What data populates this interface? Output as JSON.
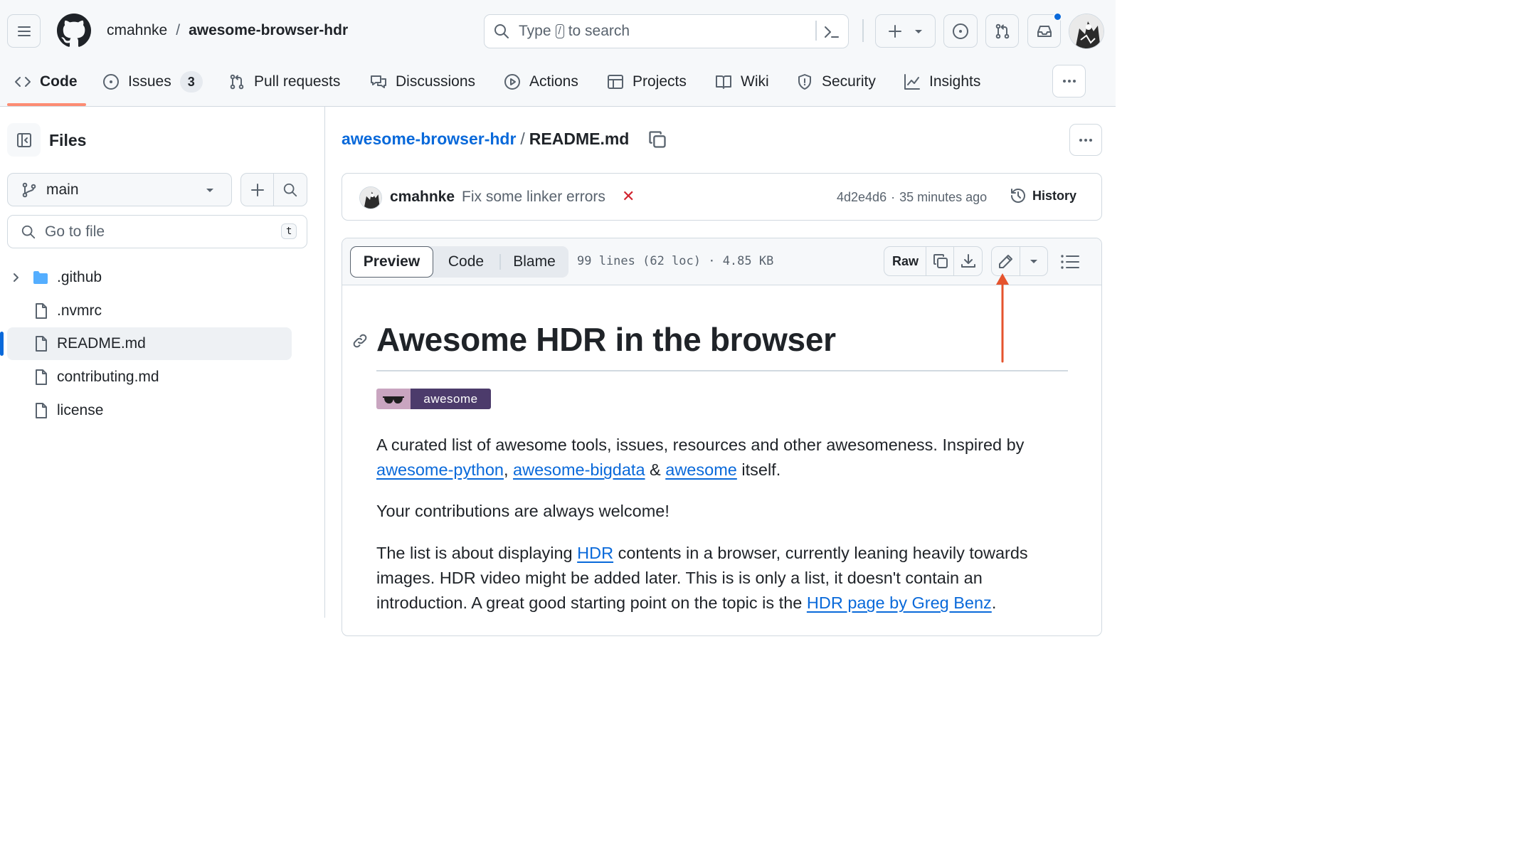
{
  "header": {
    "owner": "cmahnke",
    "separator": "/",
    "repo": "awesome-browser-hdr",
    "search": {
      "prefix": "Type",
      "key": "/",
      "suffix": "to search"
    }
  },
  "tabs": [
    {
      "label": "Code",
      "icon": "code-icon",
      "active": true
    },
    {
      "label": "Issues",
      "icon": "issue-opened-icon",
      "count": "3"
    },
    {
      "label": "Pull requests",
      "icon": "git-pull-request-icon"
    },
    {
      "label": "Discussions",
      "icon": "comment-discussion-icon"
    },
    {
      "label": "Actions",
      "icon": "play-icon"
    },
    {
      "label": "Projects",
      "icon": "table-icon"
    },
    {
      "label": "Wiki",
      "icon": "book-icon"
    },
    {
      "label": "Security",
      "icon": "shield-icon"
    },
    {
      "label": "Insights",
      "icon": "graph-icon"
    }
  ],
  "sidebar": {
    "title": "Files",
    "branch": "main",
    "search_placeholder": "Go to file",
    "search_key": "t",
    "files": [
      {
        "name": ".github",
        "type": "folder"
      },
      {
        "name": ".nvmrc",
        "type": "file"
      },
      {
        "name": "README.md",
        "type": "file",
        "selected": true
      },
      {
        "name": "contributing.md",
        "type": "file"
      },
      {
        "name": "license",
        "type": "file"
      }
    ]
  },
  "breadcrumb": {
    "repo": "awesome-browser-hdr",
    "separator": "/",
    "file": "README.md"
  },
  "commit": {
    "author": "cmahnke",
    "message": "Fix some linker errors",
    "status": "✕",
    "sha": "4d2e4d6",
    "dot": "·",
    "time": "35 minutes ago",
    "history_label": "History"
  },
  "file_toolbar": {
    "tabs": [
      "Preview",
      "Code",
      "Blame"
    ],
    "active_tab": "Preview",
    "info": "99 lines (62 loc) · 4.85 KB",
    "raw_label": "Raw"
  },
  "readme": {
    "title": "Awesome HDR in the browser",
    "badge": "awesome",
    "p1_text": "A curated list of awesome tools, issues, resources and other awesomeness. Inspired by",
    "p1_link1": "awesome-python",
    "p1_comma": ", ",
    "p1_link2": "awesome-bigdata",
    "p1_amp": " & ",
    "p1_link3": "awesome",
    "p1_end": " itself.",
    "p2": "Your contributions are always welcome!",
    "p3_start": "The list is about displaying ",
    "p3_link1": "HDR",
    "p3_mid": " contents in a browser, currently leaning heavily towards images. HDR video might be added later. This is is only a list, it doesn't contain an introduction. A great good starting point on the topic is the ",
    "p3_link2": "HDR page by Greg Benz",
    "p3_end": "."
  },
  "colors": {
    "accent": "#0969da",
    "tab_underline": "#fd8c73",
    "annotation_arrow": "#e5532d",
    "folder": "#54aeff",
    "error": "#d1242f",
    "notification": "#0969da",
    "badge_left": "#c9a5c0",
    "badge_right": "#4c3b6b"
  }
}
